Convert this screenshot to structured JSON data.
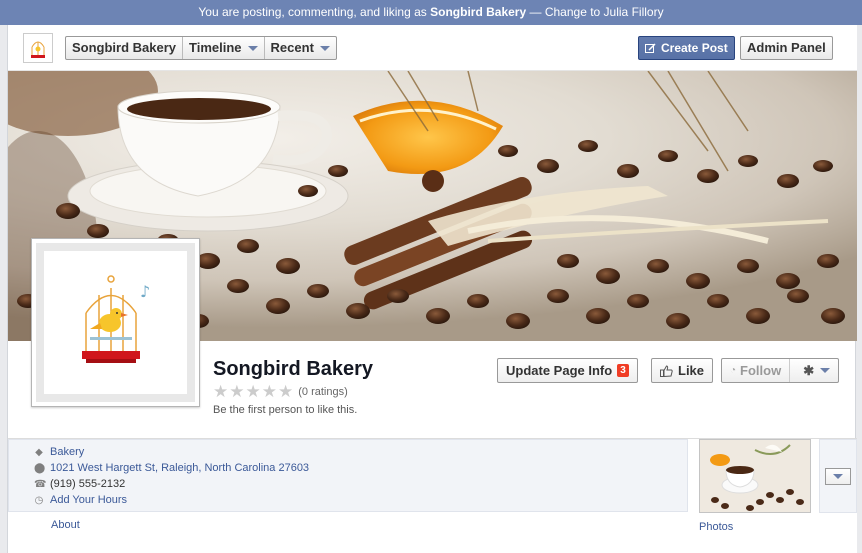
{
  "topbar": {
    "prefix": "You are posting, commenting, and liking as",
    "page_name": "Songbird Bakery",
    "separator": "—",
    "change_link": "Change to Julia Fillory"
  },
  "toolbar": {
    "nav": [
      {
        "label": "Songbird Bakery"
      },
      {
        "label": "Timeline",
        "dropdown": true
      },
      {
        "label": "Recent",
        "dropdown": true
      }
    ],
    "create_post": "Create Post",
    "admin_panel": "Admin Panel"
  },
  "page": {
    "name": "Songbird Bakery",
    "rating_text": "(0 ratings)",
    "stars": 0,
    "like_prompt": "Be the first person to like this."
  },
  "actions": {
    "update_info": "Update Page Info",
    "update_badge": "3",
    "like": "Like",
    "follow": "Follow"
  },
  "info": {
    "category": "Bakery",
    "address": "1021 West Hargett St, Raleigh, North Carolina 27603",
    "phone": "(919) 555-2132",
    "hours": "Add Your Hours"
  },
  "tabs": {
    "about": "About",
    "photos": "Photos"
  },
  "colors": {
    "topbar": "#6d84b4",
    "link": "#3b5998",
    "create_post": "#5872a7",
    "badge": "#f03d25"
  }
}
